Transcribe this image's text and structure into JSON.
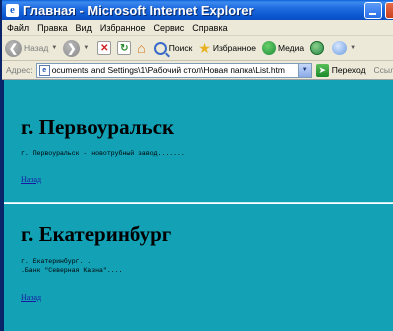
{
  "window": {
    "title": "Главная - Microsoft Internet Explorer",
    "title_icon_glyph": "e"
  },
  "menu": [
    "Файл",
    "Правка",
    "Вид",
    "Избранное",
    "Сервис",
    "Справка"
  ],
  "toolbar": {
    "back_label": "Назад",
    "search_label": "Поиск",
    "favorites_label": "Избранное",
    "media_label": "Медиа"
  },
  "address": {
    "label": "Адрес:",
    "url": "ocuments and Settings\\1\\Рабочий стол\\Новая папка\\List.htm",
    "go_label": "Переход",
    "links_label": "Ссыл"
  },
  "page": {
    "section1": {
      "heading": "г. Первоуральск",
      "text": "г. Первоуральск - новотрубный завод.......",
      "link": "Назад"
    },
    "section2": {
      "heading": "г. Екатеринбург",
      "line1": "г. Екатеринбург. .",
      "line2": ".Банк \"Северная Казна\"....",
      "link": "Назад"
    }
  },
  "colors": {
    "page_background": "#13a1b6",
    "titlebar": "#0b57d0",
    "link": "#1a1aa0"
  }
}
